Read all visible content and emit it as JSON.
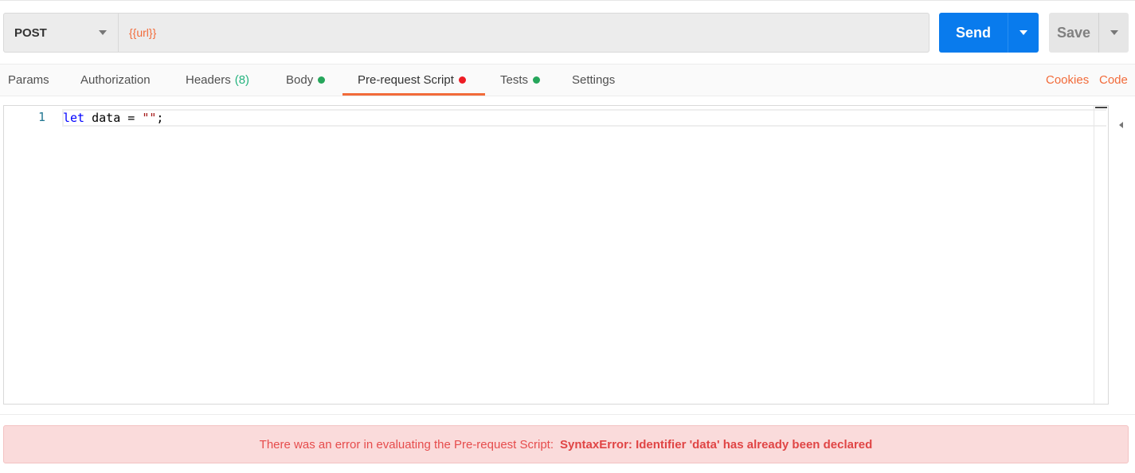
{
  "request": {
    "method": "POST",
    "url": "{{url}}",
    "send_label": "Send",
    "save_label": "Save"
  },
  "tabs": [
    {
      "label": "Params"
    },
    {
      "label": "Authorization"
    },
    {
      "label": "Headers",
      "count": "(8)"
    },
    {
      "label": "Body",
      "status": "green"
    },
    {
      "label": "Pre-request Script",
      "status": "red",
      "active": true
    },
    {
      "label": "Tests",
      "status": "green"
    },
    {
      "label": "Settings"
    }
  ],
  "links": {
    "cookies": "Cookies",
    "code": "Code"
  },
  "editor": {
    "line_number": "1",
    "code": {
      "keyword": "let",
      "rest_before_string": " data = ",
      "string": "\"\"",
      "rest_after_string": ";"
    }
  },
  "error": {
    "message": "There was an error in evaluating the Pre-request Script:",
    "detail": "SyntaxError: Identifier 'data' has already been declared"
  },
  "colors": {
    "accent": "#f26b3a",
    "send": "#097bed",
    "status_green": "#26a65b",
    "status_red": "#ed1c24",
    "error_bg": "#fadbdb"
  }
}
